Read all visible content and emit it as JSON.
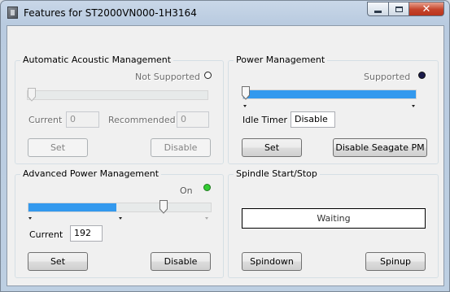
{
  "window": {
    "title": "Features for ST2000VN000-1H3164",
    "buttons": {
      "minimize": "minimize",
      "maximize": "maximize",
      "close": "✕"
    }
  },
  "aam": {
    "title": "Automatic Acoustic Management",
    "status": "Not Supported",
    "status_color": "#ffffff",
    "slider_value": 0,
    "current_label": "Current",
    "current_value": "0",
    "recommended_label": "Recommended",
    "recommended_value": "0",
    "set_label": "Set",
    "disable_label": "Disable"
  },
  "pm": {
    "title": "Power Management",
    "status": "Supported",
    "status_color": "#1a1a4a",
    "slider_fill": 1.0,
    "idle_timer_label": "Idle Timer",
    "idle_timer_value": "Disable",
    "set_label": "Set",
    "disable_label": "Disable Seagate PM"
  },
  "apm": {
    "title": "Advanced Power Management",
    "status": "On",
    "status_color": "#33cc33",
    "slider_fill": 0.48,
    "current_label": "Current",
    "current_value": "192",
    "set_label": "Set",
    "disable_label": "Disable"
  },
  "spindle": {
    "title": "Spindle Start/Stop",
    "status_text": "Waiting",
    "spindown_label": "Spindown",
    "spinup_label": "Spinup"
  }
}
